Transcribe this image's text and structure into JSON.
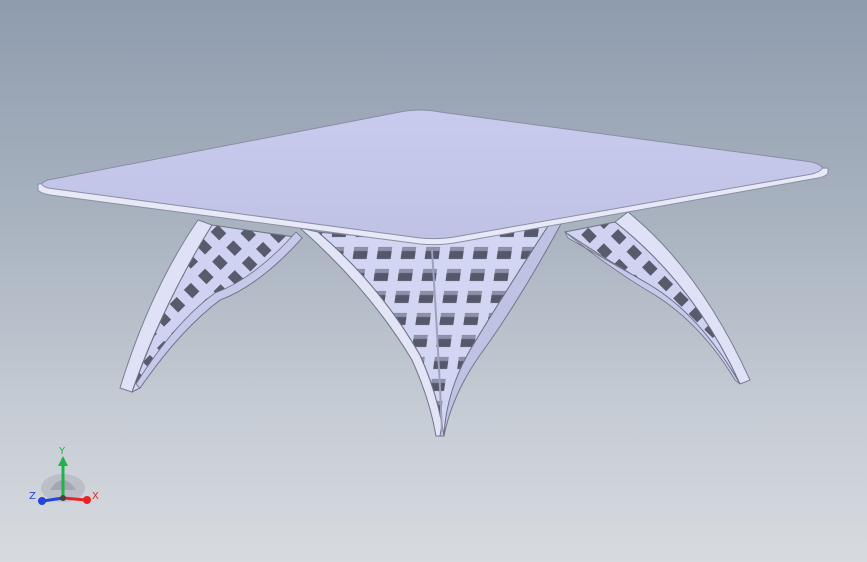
{
  "viewport": {
    "background_top": "#8f9cae",
    "background_bottom": "#d7dbe0"
  },
  "model": {
    "name": "table-with-lattice-arch-legs",
    "top_color": "#c5c8e8",
    "edge_color": "#e6e7f4",
    "leg_color": "#c8ccec",
    "leg_shadow": "#5d6070"
  },
  "triad": {
    "x_label": "X",
    "y_label": "Y",
    "z_label": "Z",
    "x_color": "#e8232a",
    "y_color": "#22b24c",
    "z_color": "#2544d8"
  }
}
